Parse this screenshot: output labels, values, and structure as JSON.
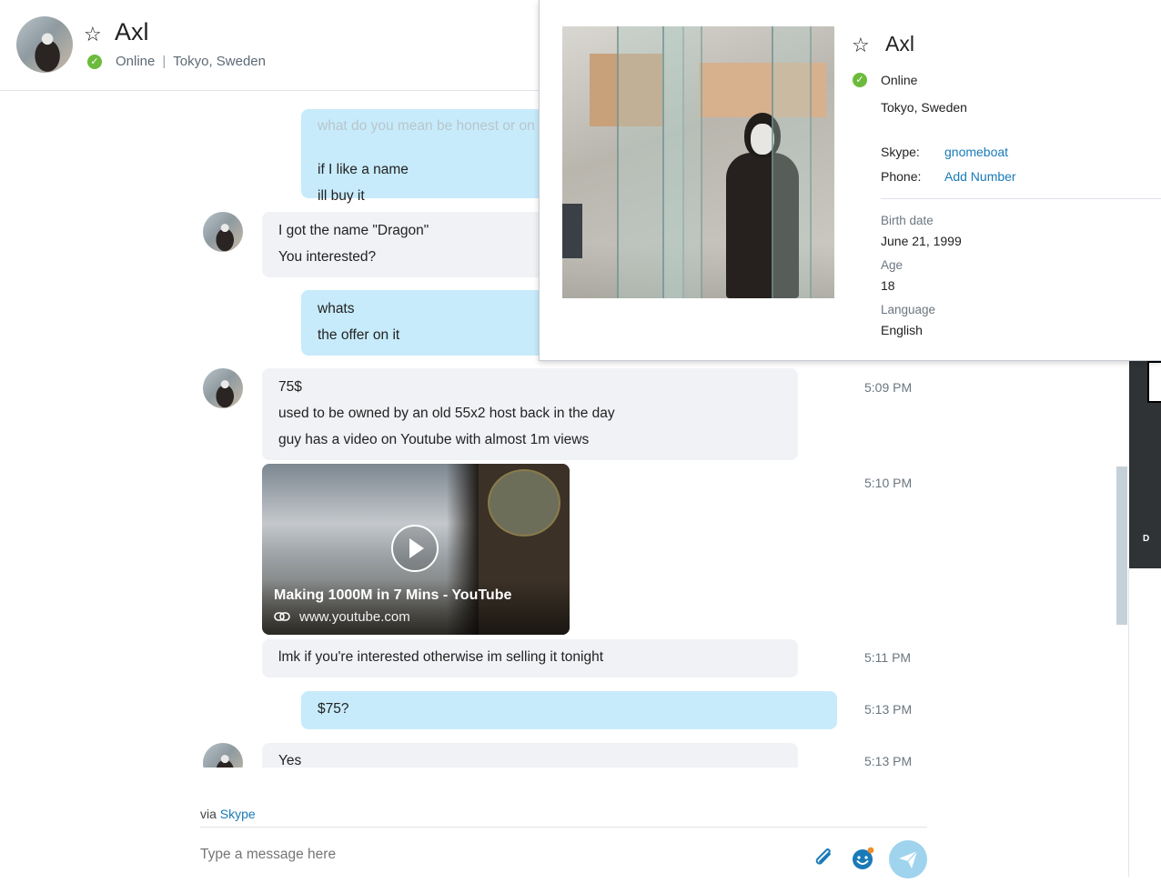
{
  "header": {
    "name": "Axl",
    "status": "Online",
    "separator": "|",
    "location": "Tokyo, Sweden"
  },
  "messages": {
    "m1_faded": "what do you mean be honest or on",
    "m1_line1": "if I like a name",
    "m1_line2": "ill buy it",
    "m2_line1": "I got the name \"Dragon\"",
    "m2_line2": "You interested?",
    "m3_line1": "whats",
    "m3_line2": "the offer on it",
    "m4_line1": "75$",
    "m4_line2": "used to be owned by an old 55x2 host back in the day",
    "m4_line3": "guy has a video on Youtube with almost 1m views",
    "m4_time": "5:09 PM",
    "video_title": "Making 1000M in 7 Mins - YouTube",
    "video_url": "www.youtube.com",
    "video_time": "5:10 PM",
    "m5_line1": "lmk if you're interested otherwise im selling it tonight",
    "m5_time": "5:11 PM",
    "m6_line1": "$75?",
    "m6_time": "5:13 PM",
    "m7_line1": "Yes",
    "m7_time": "5:13 PM"
  },
  "footer": {
    "via": "via",
    "via_link": "Skype",
    "placeholder": "Type a message here"
  },
  "profile": {
    "name": "Axl",
    "status": "Online",
    "location": "Tokyo, Sweden",
    "skype_label": "Skype:",
    "skype_value": "gnomeboat",
    "phone_label": "Phone:",
    "phone_value": "Add Number",
    "birth_label": "Birth date",
    "birth_value": "June 21, 1999",
    "age_label": "Age",
    "age_value": "18",
    "language_label": "Language",
    "language_value": "English"
  },
  "ad": {
    "text": "D"
  },
  "colors": {
    "accent": "#1a7ab8",
    "online": "#6cbb3c",
    "outgoing_bubble": "#c7ebfb",
    "incoming_bubble": "#f0f2f5",
    "send_button": "#9fd3ee"
  },
  "icons": {
    "favorite": "star-outline-icon",
    "status": "check-circle-icon",
    "attach": "paperclip-icon",
    "emoji": "emoji-icon",
    "send": "paper-plane-icon",
    "link": "link-icon",
    "play": "play-icon"
  }
}
